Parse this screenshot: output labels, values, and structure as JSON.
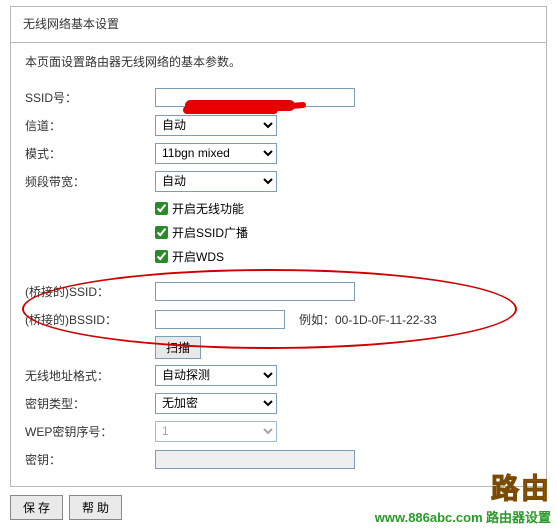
{
  "panel": {
    "title": "无线网络基本设置",
    "intro": "本页面设置路由器无线网络的基本参数。"
  },
  "fields": {
    "ssid_label": "SSID号：",
    "ssid_value": "",
    "channel_label": "信道：",
    "channel_value": "自动",
    "mode_label": "模式：",
    "mode_value": "11bgn mixed",
    "bandwidth_label": "频段带宽：",
    "bandwidth_value": "自动",
    "cb_wireless": "开启无线功能",
    "cb_ssid_broadcast": "开启SSID广播",
    "cb_wds": "开启WDS",
    "bridge_ssid_label": "(桥接的)SSID：",
    "bridge_ssid_value": "",
    "bridge_bssid_label": "(桥接的)BSSID：",
    "bridge_bssid_value": "",
    "bridge_bssid_hint": "例如：00-1D-0F-11-22-33",
    "scan_button": "扫描",
    "addr_fmt_label": "无线地址格式：",
    "addr_fmt_value": "自动探测",
    "key_type_label": "密钥类型：",
    "key_type_value": "无加密",
    "wep_index_label": "WEP密钥序号：",
    "wep_index_value": "1",
    "key_label": "密钥：",
    "key_value": ""
  },
  "footer": {
    "save": "保 存",
    "help": "帮 助"
  },
  "watermark": {
    "brand": "路由",
    "url": "www.886abc.com",
    "cn": "路由器设置"
  }
}
